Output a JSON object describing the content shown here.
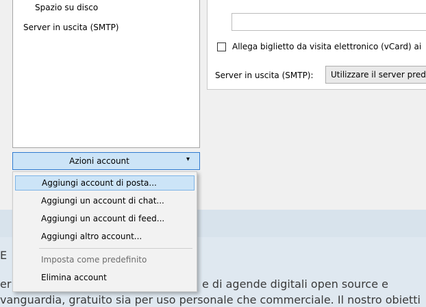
{
  "account_tree": {
    "items": [
      {
        "label": "Spazio su disco"
      },
      {
        "label": "Server in uscita (SMTP)"
      }
    ]
  },
  "settings": {
    "vcard_checkbox_label": "Allega biglietto da visita elettronico (vCard) ai",
    "vcard_checked": false,
    "smtp_label": "Server in uscita (SMTP):",
    "smtp_value": "Utilizzare il server prede"
  },
  "account_actions": {
    "button_label": "Azioni account",
    "arrow": "▾",
    "menu": [
      {
        "label": "Aggiungi account di posta...",
        "highlighted": true,
        "disabled": false
      },
      {
        "label": "Aggiungi un account di chat...",
        "highlighted": false,
        "disabled": false
      },
      {
        "label": "Aggiungi un account di feed...",
        "highlighted": false,
        "disabled": false
      },
      {
        "label": "Aggiungi altro account...",
        "highlighted": false,
        "disabled": false
      },
      {
        "label": "Imposta come predefinito",
        "highlighted": false,
        "disabled": true
      },
      {
        "label": "Elimina account",
        "highlighted": false,
        "disabled": false
      }
    ]
  },
  "background_page": {
    "fragment_left": "E",
    "line1_left": "er",
    "line1_right": "e di agende digitali open source e",
    "line2": "vanguardia, gratuito sia per uso personale che commerciale. Il nostro obietti"
  }
}
